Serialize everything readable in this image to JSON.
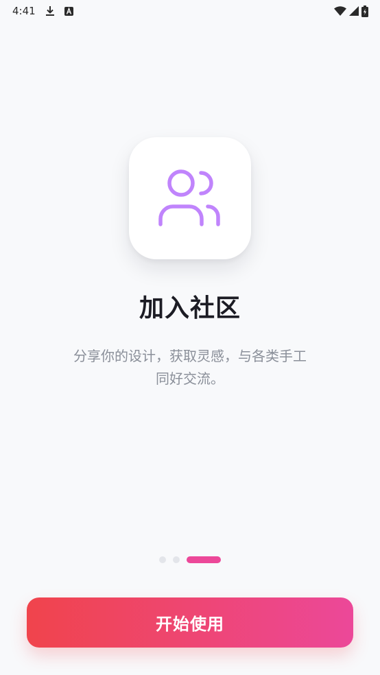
{
  "status_bar": {
    "time": "4:41",
    "icons": [
      "download-icon",
      "a-badge-icon",
      "wifi-icon",
      "signal-icon",
      "battery-icon"
    ]
  },
  "hero": {
    "icon": "users-icon",
    "icon_color": "#c084fc"
  },
  "title": "加入社区",
  "description_line1": "分享你的设计，获取灵感，与各类手工",
  "description_line2": "同好交流。",
  "pager": {
    "total": 3,
    "active_index": 2,
    "active_color": "#ec4899"
  },
  "start_button": {
    "label": "开始使用",
    "gradient_start": "#f0444c",
    "gradient_end": "#ec4899"
  }
}
